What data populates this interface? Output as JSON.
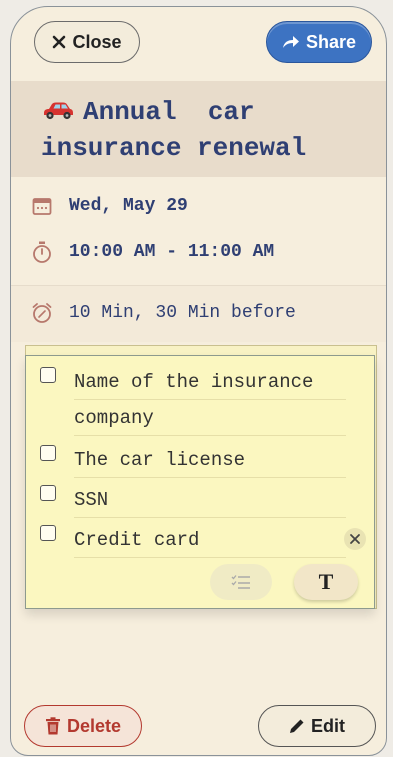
{
  "header": {
    "close_label": "Close",
    "share_label": "Share"
  },
  "event": {
    "title": "Annual  car\ninsurance renewal",
    "date": "Wed, May 29",
    "time": "10:00 AM - 11:00 AM",
    "reminder": "10 Min, 30 Min before"
  },
  "checklist": {
    "items": [
      {
        "lines": [
          "Name of the insurance",
          "company"
        ],
        "checked": false
      },
      {
        "lines": [
          "The car license"
        ],
        "checked": false
      },
      {
        "lines": [
          "SSN"
        ],
        "checked": false
      },
      {
        "lines": [
          "Credit card"
        ],
        "checked": false
      }
    ]
  },
  "footer": {
    "delete_label": "Delete",
    "edit_label": "Edit"
  },
  "icons": {
    "close": "close-icon",
    "share": "share-arrow-icon",
    "title": "car-icon",
    "date": "calendar-icon",
    "time": "stopwatch-icon",
    "reminder": "alarm-clock-icon",
    "clear": "clear-x-icon",
    "list": "checklist-icon",
    "text": "text-format-icon",
    "delete": "trash-icon",
    "edit": "pencil-icon"
  },
  "colors": {
    "accent": "#3d73c2",
    "title_text": "#2f3f73",
    "danger": "#b3392f",
    "note": "#fbf7c0",
    "background": "#f6eedd"
  }
}
